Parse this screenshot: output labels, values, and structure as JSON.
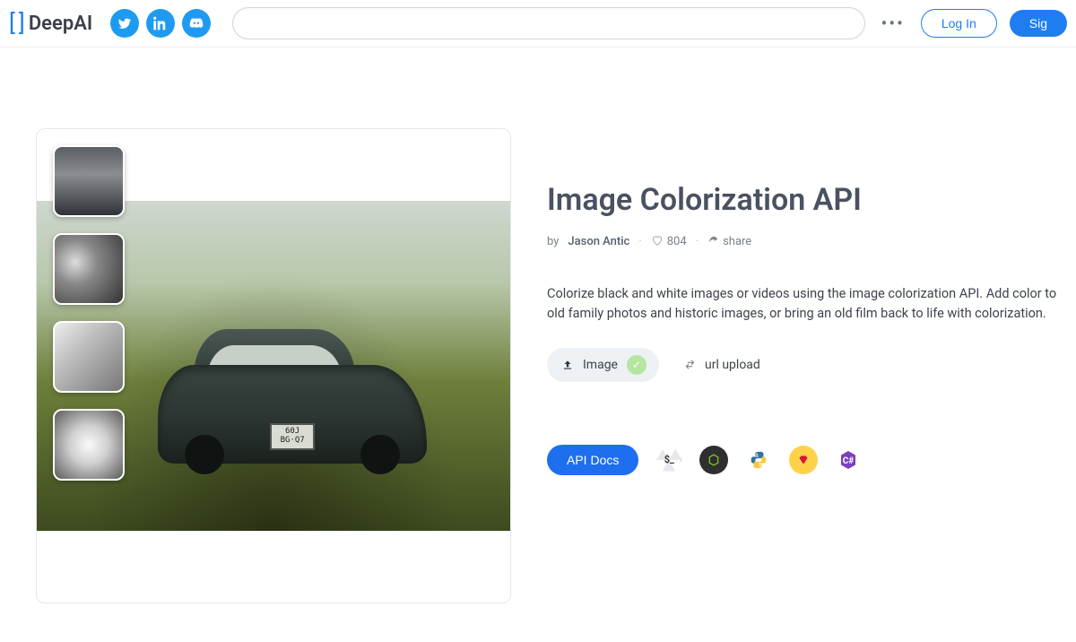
{
  "header": {
    "brand": "DeepAI",
    "login_label": "Log In",
    "signup_label": "Sig",
    "search_placeholder": ""
  },
  "title": "Image Colorization API",
  "meta": {
    "by_prefix": "by",
    "author": "Jason Antic",
    "likes": "804",
    "share_label": "share"
  },
  "description": "Colorize black and white images or videos using the image colorization API. Add color to old family photos and historic images, or bring an old film back to life with colorization.",
  "upload": {
    "image_label": "Image",
    "url_label": "url upload"
  },
  "docs": {
    "button_label": "API Docs"
  },
  "plate": {
    "line1": "60J",
    "line2": "BG·Q7"
  }
}
